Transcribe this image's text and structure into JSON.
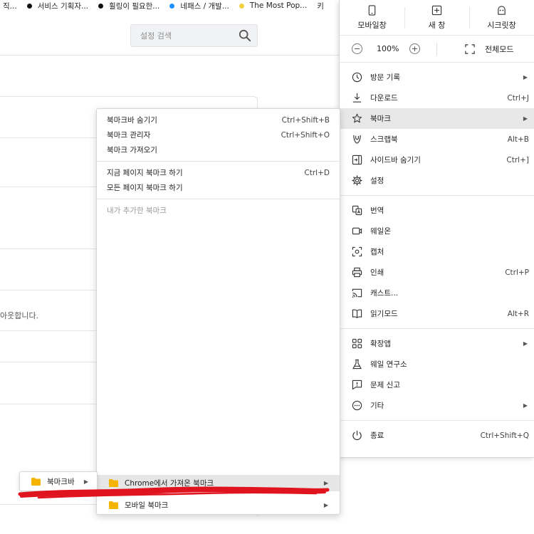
{
  "bookmarks_bar": {
    "items": [
      {
        "label": "직...",
        "dot": ""
      },
      {
        "label": "서비스 기획자...",
        "dot": "#111111"
      },
      {
        "label": "휠링이 필요한...",
        "dot": "#111111"
      },
      {
        "label": "네패스 / 개발...",
        "dot": "#1e90ff"
      },
      {
        "label": "The Most Pop...",
        "dot": "#f4d03f"
      },
      {
        "label": "키",
        "dot": ""
      }
    ]
  },
  "settings": {
    "search_placeholder": "설정 검색",
    "partial_text": "아웃합니다."
  },
  "menu": {
    "top_buttons": [
      {
        "label": "모바일창",
        "icon": "mobile-icon"
      },
      {
        "label": "새 창",
        "icon": "new-window-icon"
      },
      {
        "label": "시크릿창",
        "icon": "incognito-icon"
      }
    ],
    "zoom": {
      "minus": "−",
      "value": "100%",
      "plus": "+",
      "fullscreen_label": "전체모드"
    },
    "sections": [
      [
        {
          "label": "방문 기록",
          "shortcut": "",
          "submenu": true,
          "icon": "history-icon"
        },
        {
          "label": "다운로드",
          "shortcut": "Ctrl+J",
          "submenu": false,
          "icon": "download-icon"
        },
        {
          "label": "북마크",
          "shortcut": "",
          "submenu": true,
          "icon": "star-icon",
          "active": true
        },
        {
          "label": "스크랩북",
          "shortcut": "Alt+B",
          "submenu": false,
          "icon": "scrapbook-icon"
        },
        {
          "label": "사이드바 숨기기",
          "shortcut": "Ctrl+]",
          "submenu": false,
          "icon": "sidebar-icon"
        },
        {
          "label": "설정",
          "shortcut": "",
          "submenu": false,
          "icon": "gear-icon"
        }
      ],
      [
        {
          "label": "번역",
          "shortcut": "",
          "submenu": false,
          "icon": "translate-icon"
        },
        {
          "label": "웨일온",
          "shortcut": "",
          "submenu": false,
          "icon": "video-icon"
        },
        {
          "label": "캡처",
          "shortcut": "",
          "submenu": false,
          "icon": "capture-icon"
        },
        {
          "label": "인쇄",
          "shortcut": "Ctrl+P",
          "submenu": false,
          "icon": "print-icon"
        },
        {
          "label": "캐스트...",
          "shortcut": "",
          "submenu": false,
          "icon": "cast-icon"
        },
        {
          "label": "읽기모드",
          "shortcut": "Alt+R",
          "submenu": false,
          "icon": "book-icon"
        }
      ],
      [
        {
          "label": "확장앱",
          "shortcut": "",
          "submenu": true,
          "icon": "extensions-icon"
        },
        {
          "label": "웨일 연구소",
          "shortcut": "",
          "submenu": false,
          "icon": "flask-icon"
        },
        {
          "label": "문제 신고",
          "shortcut": "",
          "submenu": false,
          "icon": "report-icon"
        },
        {
          "label": "기타",
          "shortcut": "",
          "submenu": true,
          "icon": "more-icon"
        }
      ],
      [
        {
          "label": "종료",
          "shortcut": "Ctrl+Shift+Q",
          "submenu": false,
          "icon": "power-icon"
        }
      ]
    ]
  },
  "bookmark_menu": {
    "group1": [
      {
        "label": "북마크바 숨기기",
        "shortcut": "Ctrl+Shift+B"
      },
      {
        "label": "북마크 관리자",
        "shortcut": "Ctrl+Shift+O"
      },
      {
        "label": "북마크 가져오기",
        "shortcut": ""
      }
    ],
    "group2": [
      {
        "label": "지금 페이지 북마크 하기",
        "shortcut": "Ctrl+D"
      },
      {
        "label": "모든 페이지 북마크 하기",
        "shortcut": ""
      }
    ],
    "added_header": "내가 추가한 북마크",
    "folders": [
      {
        "label": "Chrome에서 가져온 북마크",
        "active": true
      },
      {
        "label": "모바일 북마크",
        "active": false
      }
    ]
  },
  "bar_flyout": {
    "label": "북마크바"
  },
  "colors": {
    "folder": "#f4b400",
    "active_row": "#e8e8e8",
    "annotation_red": "#e0141e"
  }
}
